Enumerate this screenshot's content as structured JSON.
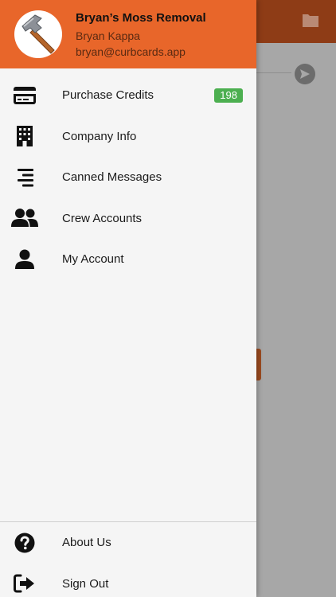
{
  "header": {
    "title": "Bryan’s Moss Removal",
    "name": "Bryan Kappa",
    "email": "bryan@curbcards.app"
  },
  "menu": {
    "items": [
      {
        "label": "Purchase Credits",
        "icon": "credit-card-icon",
        "badge": "198"
      },
      {
        "label": "Company Info",
        "icon": "building-icon"
      },
      {
        "label": "Canned Messages",
        "icon": "align-right-icon"
      },
      {
        "label": "Crew Accounts",
        "icon": "users-icon"
      },
      {
        "label": "My Account",
        "icon": "user-icon"
      }
    ]
  },
  "bottom": {
    "items": [
      {
        "label": "About Us",
        "icon": "question-circle-icon"
      },
      {
        "label": "Sign Out",
        "icon": "sign-out-icon"
      }
    ]
  },
  "colors": {
    "header_bg": "#e8662a",
    "badge_bg": "#4caf50",
    "drawer_bg": "#f5f5f5"
  }
}
